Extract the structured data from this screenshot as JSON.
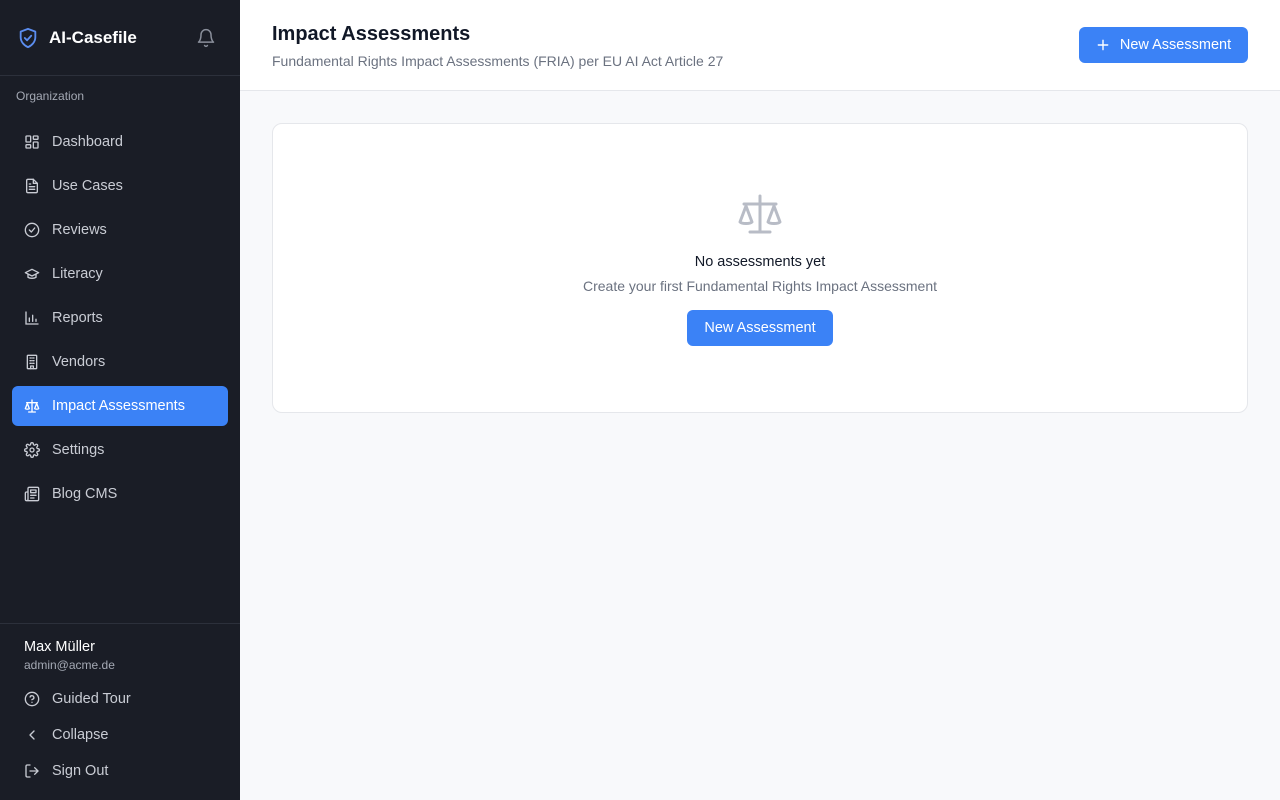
{
  "app": {
    "name": "AI-Casefile"
  },
  "sidebar": {
    "section_label": "Organization",
    "items": [
      {
        "label": "Dashboard",
        "icon": "dashboard-icon"
      },
      {
        "label": "Use Cases",
        "icon": "file-icon"
      },
      {
        "label": "Reviews",
        "icon": "check-circle-icon"
      },
      {
        "label": "Literacy",
        "icon": "graduation-cap-icon"
      },
      {
        "label": "Reports",
        "icon": "bar-chart-icon"
      },
      {
        "label": "Vendors",
        "icon": "building-icon"
      },
      {
        "label": "Impact Assessments",
        "icon": "scale-icon",
        "active": true
      },
      {
        "label": "Settings",
        "icon": "gear-icon"
      },
      {
        "label": "Blog CMS",
        "icon": "newspaper-icon"
      }
    ],
    "user": {
      "name": "Max Müller",
      "email": "admin@acme.de"
    },
    "footer_items": [
      {
        "label": "Guided Tour",
        "icon": "help-circle-icon"
      },
      {
        "label": "Collapse",
        "icon": "chevron-left-icon"
      },
      {
        "label": "Sign Out",
        "icon": "sign-out-icon"
      }
    ]
  },
  "header": {
    "title": "Impact Assessments",
    "subtitle": "Fundamental Rights Impact Assessments (FRIA) per EU AI Act Article 27",
    "new_button_label": "New Assessment"
  },
  "empty_state": {
    "title": "No assessments yet",
    "description": "Create your first Fundamental Rights Impact Assessment",
    "button_label": "New Assessment"
  },
  "colors": {
    "sidebar_bg": "#1a1d26",
    "accent": "#3b82f6",
    "page_bg": "#f8f9fb"
  }
}
